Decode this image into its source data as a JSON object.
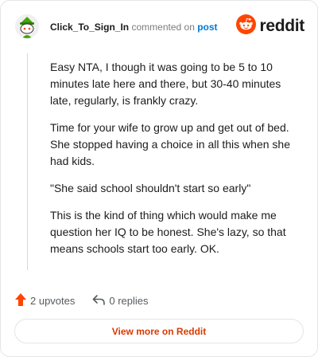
{
  "header": {
    "author": "Click_To_Sign_In",
    "commented_text": "commented on",
    "post_link": "post",
    "brand_name": "reddit"
  },
  "comment": {
    "paragraphs": [
      "Easy NTA, I though it was going to be 5 to 10 minutes late here and there, but 30-40 minutes late, regularly, is frankly crazy.",
      "Time for your wife to grow up and get out of bed. She stopped having a choice in all this when she had kids.",
      "\"She said school shouldn't start so early\"",
      "This is the kind of thing which would make me question her IQ to be honest. She's lazy, so that means schools start too early. OK."
    ]
  },
  "actions": {
    "upvotes": "2 upvotes",
    "replies": "0 replies"
  },
  "footer": {
    "view_more": "View more on Reddit"
  },
  "colors": {
    "brand_orange": "#ff4500",
    "upvote_orange": "#ff4500",
    "link_blue": "#0079d3",
    "view_more_text": "#d93a00"
  },
  "icons": {
    "avatar": "snoo-avatar-icon",
    "brand": "reddit-logo-icon",
    "upvote": "upvote-arrow-icon",
    "reply": "reply-arrow-icon"
  }
}
